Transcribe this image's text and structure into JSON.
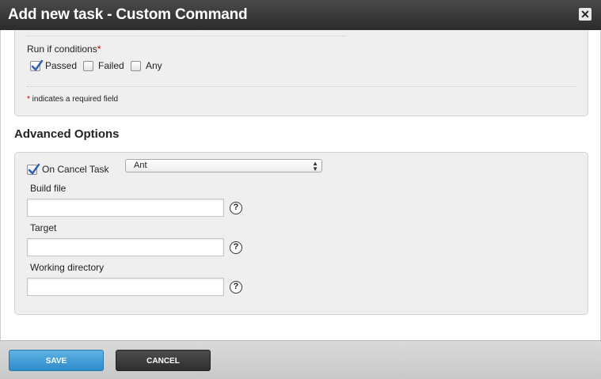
{
  "dialog": {
    "title": "Add new task - Custom Command",
    "close_glyph": "✕"
  },
  "conditions": {
    "label": "Run if conditions",
    "required_mark": "*",
    "options": [
      {
        "label": "Passed",
        "checked": true
      },
      {
        "label": "Failed",
        "checked": false
      },
      {
        "label": "Any",
        "checked": false
      }
    ],
    "required_note_mark": "*",
    "required_note": " indicates a required field"
  },
  "advanced": {
    "heading": "Advanced Options",
    "on_cancel": {
      "label": "On Cancel Task",
      "checked": true
    },
    "select": {
      "value": "Ant"
    },
    "fields": [
      {
        "label": "Build file",
        "value": "",
        "help": "?"
      },
      {
        "label": "Target",
        "value": "",
        "help": "?"
      },
      {
        "label": "Working directory",
        "value": "",
        "help": "?"
      }
    ]
  },
  "footer": {
    "save_label": "SAVE",
    "cancel_label": "CANCEL"
  },
  "colors": {
    "titlebar": "#333333",
    "save_button": "#3a97d4",
    "cancel_button": "#3a3a3a",
    "required": "#c00000",
    "checkmark": "#2a5fb3"
  }
}
